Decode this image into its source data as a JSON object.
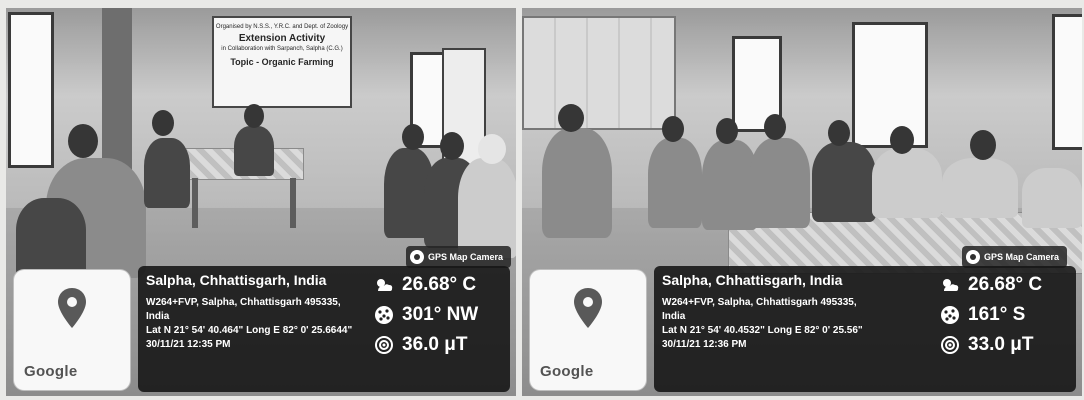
{
  "photos": [
    {
      "banner": {
        "line1": "Extension Activity",
        "line2": "Organised by N.S.S., Y.R.C. and Dept. of Zoology",
        "line3": "in Collaboration with Sarpanch, Salpha (C.G.)",
        "topic": "Topic - Organic Farming"
      },
      "gps_tag": "GPS Map Camera",
      "map": {
        "brand": "Google",
        "pin_icon": "map-pin-icon"
      },
      "place": "Salpha, Chhattisgarh, India",
      "address_line1": "W264+FVP, Salpha, Chhattisgarh 495335,",
      "address_line2": "India",
      "coords": "Lat N 21° 54' 40.464\" Long E 82° 0' 25.6644\"",
      "datetime": "30/11/21 12:35 PM",
      "temperature": "26.68° C",
      "heading": "301° NW",
      "magnetic": "36.0 μT",
      "icons": {
        "temp": "weather-icon",
        "compass": "compass-icon",
        "magnet": "magnetic-icon"
      }
    },
    {
      "gps_tag": "GPS Map Camera",
      "map": {
        "brand": "Google",
        "pin_icon": "map-pin-icon"
      },
      "place": "Salpha, Chhattisgarh, India",
      "address_line1": "W264+FVP, Salpha, Chhattisgarh 495335,",
      "address_line2": "India",
      "coords": "Lat N 21° 54' 40.4532\" Long E 82° 0' 25.56\"",
      "datetime": "30/11/21 12:36 PM",
      "temperature": "26.68° C",
      "heading": "161° S",
      "magnetic": "33.0 μT",
      "icons": {
        "temp": "weather-icon",
        "compass": "compass-icon",
        "magnet": "magnetic-icon"
      }
    }
  ],
  "colors": {
    "pin": "#5b5b5b",
    "panel": "#1c1c1c",
    "text": "#ffffff"
  }
}
